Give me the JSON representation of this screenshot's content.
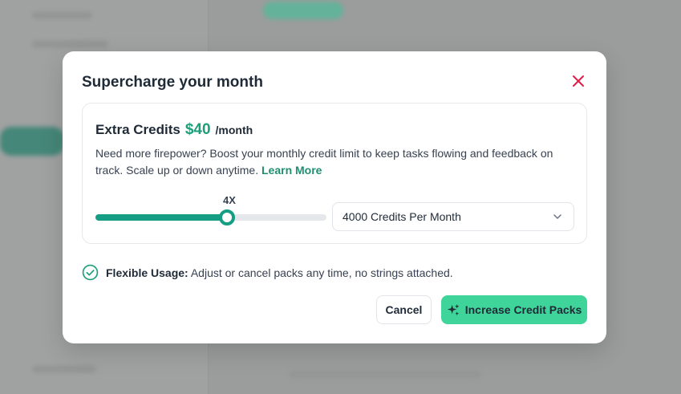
{
  "modal": {
    "title": "Supercharge your month",
    "card": {
      "title": "Extra Credits",
      "price": "$40",
      "period": "/month",
      "description": "Need more firepower? Boost your monthly credit limit to keep tasks flowing and feedback on track. Scale up or down anytime.",
      "learn_more": "Learn More",
      "slider": {
        "label": "4X",
        "fill_fraction": 0.57
      },
      "select": {
        "value": "4000 Credits Per Month"
      }
    },
    "feature": {
      "title": "Flexible Usage:",
      "text": "Adjust or cancel packs any time, no strings attached."
    },
    "buttons": {
      "cancel": "Cancel",
      "primary": "Increase Credit Packs"
    }
  },
  "colors": {
    "accent": "#169e85",
    "primary_button": "#3fd49a",
    "close": "#e11d48"
  }
}
